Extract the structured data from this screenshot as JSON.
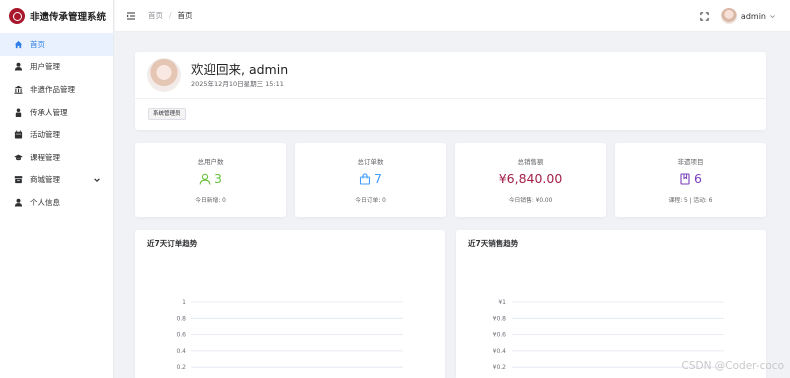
{
  "app": {
    "title": "非遗传承管理系统"
  },
  "sidebar": {
    "items": [
      {
        "label": "首页",
        "icon": "home-icon",
        "active": true
      },
      {
        "label": "用户管理",
        "icon": "user-icon"
      },
      {
        "label": "非遗作品管理",
        "icon": "bank-icon"
      },
      {
        "label": "传承人管理",
        "icon": "person-icon"
      },
      {
        "label": "活动管理",
        "icon": "calendar-icon"
      },
      {
        "label": "课程管理",
        "icon": "graduation-cap-icon"
      },
      {
        "label": "商城管理",
        "icon": "shop-icon",
        "expandable": true
      },
      {
        "label": "个人信息",
        "icon": "profile-icon"
      }
    ]
  },
  "header": {
    "breadcrumb": [
      "首页",
      "首页"
    ],
    "user": {
      "name": "admin"
    }
  },
  "welcome": {
    "title": "欢迎回来, admin",
    "datetime": "2025年12月10日星期三 15:11",
    "role": "系统管理员"
  },
  "stats": [
    {
      "label": "总用户数",
      "value": "3",
      "sub": "今日新增: 0",
      "color": "#67c23a",
      "icon": "user-outline-icon"
    },
    {
      "label": "总订单数",
      "value": "7",
      "sub": "今日订单: 0",
      "color": "#409eff",
      "icon": "shopping-bag-icon"
    },
    {
      "label": "总销售额",
      "value": "¥6,840.00",
      "sub": "今日销售: ¥0.00",
      "color": "#a31f48",
      "icon": ""
    },
    {
      "label": "非遗项目",
      "value": "6",
      "sub": "课程: 5 | 活动: 6",
      "color": "#7a3db8",
      "icon": "document-icon"
    }
  ],
  "chart_data": [
    {
      "type": "line",
      "title": "近7天订单趋势",
      "yticks": [
        "1",
        "0.8",
        "0.6",
        "0.4",
        "0.2"
      ],
      "ylim": [
        0,
        1
      ],
      "grid": true
    },
    {
      "type": "line",
      "title": "近7天销售趋势",
      "yticks": [
        "¥1",
        "¥0.8",
        "¥0.6",
        "¥0.4",
        "¥0.2"
      ],
      "ylim": [
        0,
        1
      ],
      "grid": true
    }
  ],
  "watermark": "CSDN @Coder-coco"
}
